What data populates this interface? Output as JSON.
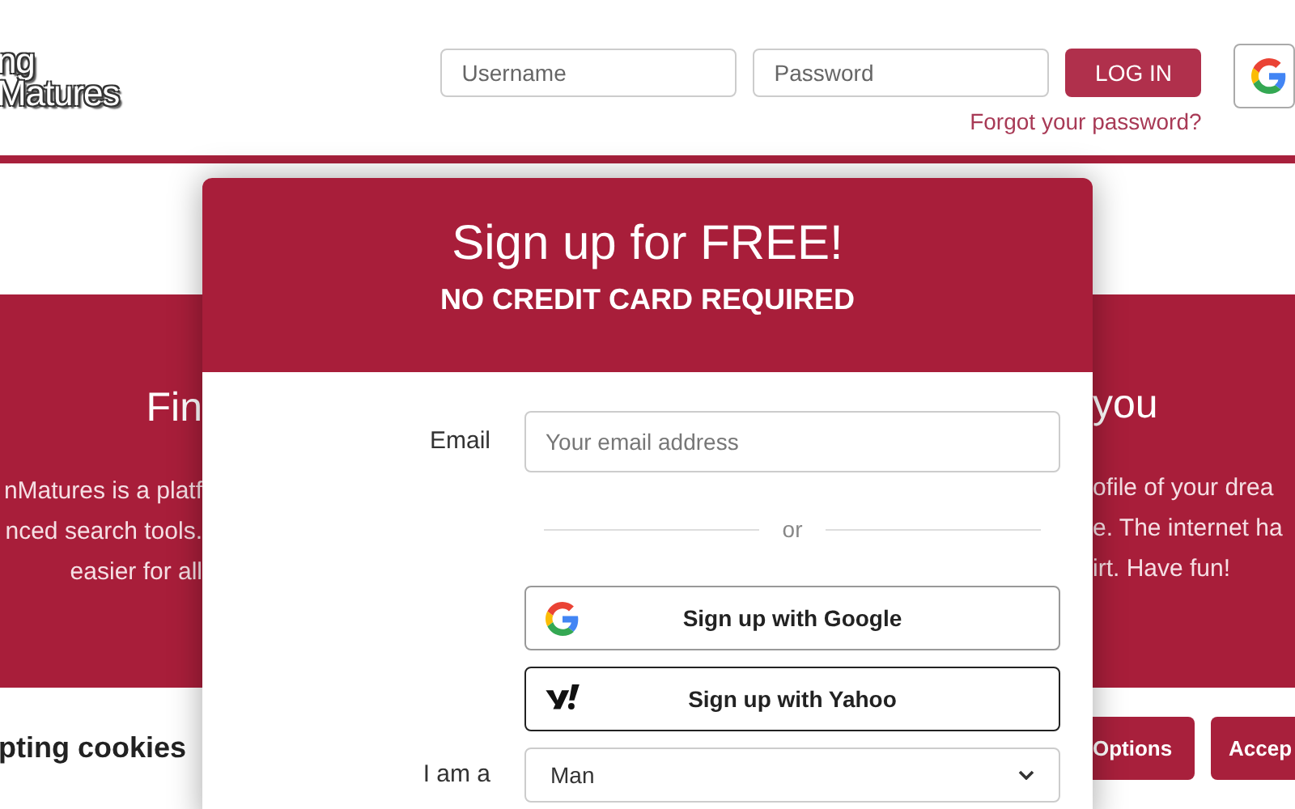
{
  "header": {
    "logo_lines": [
      "ng",
      "Matures"
    ],
    "username": {
      "placeholder": "Username"
    },
    "password": {
      "placeholder": "Password"
    },
    "login_button": "LOG IN",
    "forgot_link": "Forgot your password?"
  },
  "band": {
    "heading_left": "Fin",
    "heading_right": "you",
    "left_lines": [
      "nMatures is a platf",
      "nced search tools.",
      "easier for all"
    ],
    "right_lines": [
      "ofile of your drea",
      "e. The internet ha",
      "irt. Have fun!"
    ]
  },
  "cookie_bar": {
    "text": "pting cookies",
    "buttons": [
      "Options",
      "Accep"
    ]
  },
  "modal": {
    "title": "Sign up for FREE!",
    "subtitle": "NO CREDIT CARD REQUIRED",
    "email_label": "Email",
    "email": {
      "placeholder": "Your email address"
    },
    "divider": "or",
    "social_buttons": [
      {
        "kind": "google",
        "label": "Sign up with Google"
      },
      {
        "kind": "yahoo",
        "label": "Sign up with Yahoo"
      }
    ],
    "gender_label": "I am a",
    "gender": {
      "value": "Man"
    }
  }
}
